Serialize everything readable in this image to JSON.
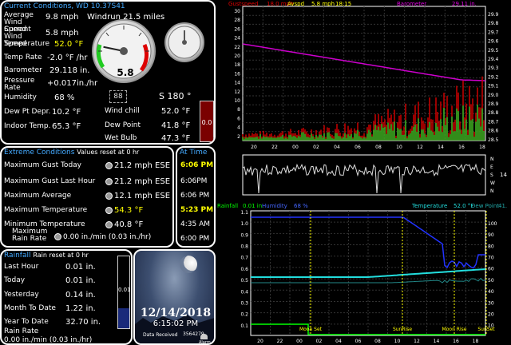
{
  "current": {
    "title": "Current Conditions, WD 10.37S41",
    "avg_wind_label": "Average Wind Speed",
    "avg_wind_value": "9.8 mph",
    "windrun": "Windrun 21.5 miles",
    "cur_wind_label": "Current Wind Speed",
    "cur_wind_value": "5.8 mph",
    "temp_label": "Temperature",
    "temp_value": "52.0 °F",
    "temprate_label": "Temp Rate",
    "temprate_value": "-2.0 °F /hr",
    "baro_label": "Barometer",
    "baro_value": "29.118 in.",
    "press_label": "Pressure Rate",
    "press_value": "+0.017in./hr",
    "hum_label": "Humidity",
    "hum_value": "68 %",
    "dew_dep_label": "Dew Pt Depr.",
    "dew_dep_value": "10.2 °F",
    "indoor_label": "Indoor Temp.",
    "indoor_value": "65.3 °F",
    "wind_dir": "S 180 °",
    "windchill_label": "Wind chill",
    "windchill_value": "52.0 °F",
    "dewpoint_label": "Dew Point",
    "dewpoint_value": "41.8 °F",
    "wetbulb_label": "Wet Bulb",
    "wetbulb_value": "47.3 °F",
    "rain_bar_value": "0.0",
    "gauge_value": "5.8",
    "gauge_level": 0.21
  },
  "extreme": {
    "title": "Extreme Conditions",
    "subtitle": "Values reset at 0 hr",
    "rows": [
      {
        "label": "Maximum Gust Today",
        "value": "21.2 mph ESE"
      },
      {
        "label": "Maximum Gust Last Hour",
        "value": "21.2 mph ESE"
      },
      {
        "label": "Maximum Average",
        "value": "12.1 mph ESE"
      },
      {
        "label": "Maximum Temperature",
        "value": "54.3 °F"
      },
      {
        "label": "Minimum Temperature",
        "value": "40.8 °F"
      },
      {
        "label": "Maximum Rain Rate",
        "value": "0.00 in./min (0.03 in./hr)"
      }
    ]
  },
  "attime": {
    "title": "At Time",
    "rows": [
      "6:06 PM",
      "6:06PM",
      "6:06 PM",
      "5:23 PM",
      "4:35 AM",
      "6:00 PM"
    ]
  },
  "rainfall": {
    "title": "Rainfall",
    "subtitle": "Rain reset at 0 hr",
    "rows": [
      {
        "label": "Last Hour",
        "value": "0.01 in."
      },
      {
        "label": "Today",
        "value": "0.01 in."
      },
      {
        "label": "Yesterday",
        "value": "0.14 in."
      },
      {
        "label": "Month To Date",
        "value": "1.22 in."
      },
      {
        "label": "Year To Date",
        "value": "32.70 in."
      }
    ],
    "rate_label": "Rain Rate",
    "rate_value": "0.00 in./min (0.03 in./hr)",
    "bar_value": "0.01"
  },
  "photo": {
    "date": "12/14/2018",
    "time": "6:15:02 PM",
    "data_received": "Data Received",
    "count": "3564279",
    "alarm": "Alarm"
  },
  "graph1": {
    "legend_gust": "Gustspeed",
    "legend_gust_value": "18.0 mph",
    "legend_avg": "Avspd",
    "legend_avg_value": "5.8 mph",
    "legend_time": "18:15",
    "legend_baro": "Barometer",
    "legend_baro_value": "29.11 in.",
    "y_left": [
      "30",
      "28",
      "26",
      "24",
      "22",
      "20",
      "18",
      "16",
      "14",
      "12",
      "10",
      "8",
      "6",
      "4",
      "2"
    ],
    "y_right": [
      "29.9",
      "29.8",
      "29.7",
      "29.6",
      "29.5",
      "29.4",
      "29.3",
      "29.2",
      "29.1",
      "29.0",
      "28.9",
      "28.8",
      "28.7",
      "28.6",
      "28.5"
    ],
    "x": [
      "20",
      "22",
      "00",
      "02",
      "04",
      "06",
      "08",
      "10",
      "12",
      "14",
      "16",
      "18"
    ]
  },
  "graph2": {
    "compass": [
      "N",
      "E",
      "S",
      "W",
      "N"
    ],
    "right_label": "14"
  },
  "graph3": {
    "legend_rain": "Rainfall",
    "legend_rain_value": "0.01 in.",
    "legend_hum": "Humidity",
    "legend_hum_value": "68 %",
    "legend_temp": "Temperature",
    "legend_temp_value": "52.0 °F",
    "legend_dew": "Dew Point",
    "legend_dew_value": "41.",
    "y_left": [
      "1.1",
      "1.0",
      "0.9",
      "0.8",
      "0.7",
      "0.6",
      "0.5",
      "0.4",
      "0.3",
      "0.2",
      "0.1"
    ],
    "y_right": [
      "100",
      "90",
      "80",
      "70",
      "60",
      "50",
      "40",
      "30",
      "20",
      "10"
    ],
    "x": [
      "20",
      "22",
      "00",
      "02",
      "04",
      "06",
      "08",
      "10",
      "12",
      "14",
      "16",
      "18"
    ],
    "events": [
      "Moon Set",
      "SunRise",
      "Moon Rise",
      "SunSet"
    ]
  }
}
